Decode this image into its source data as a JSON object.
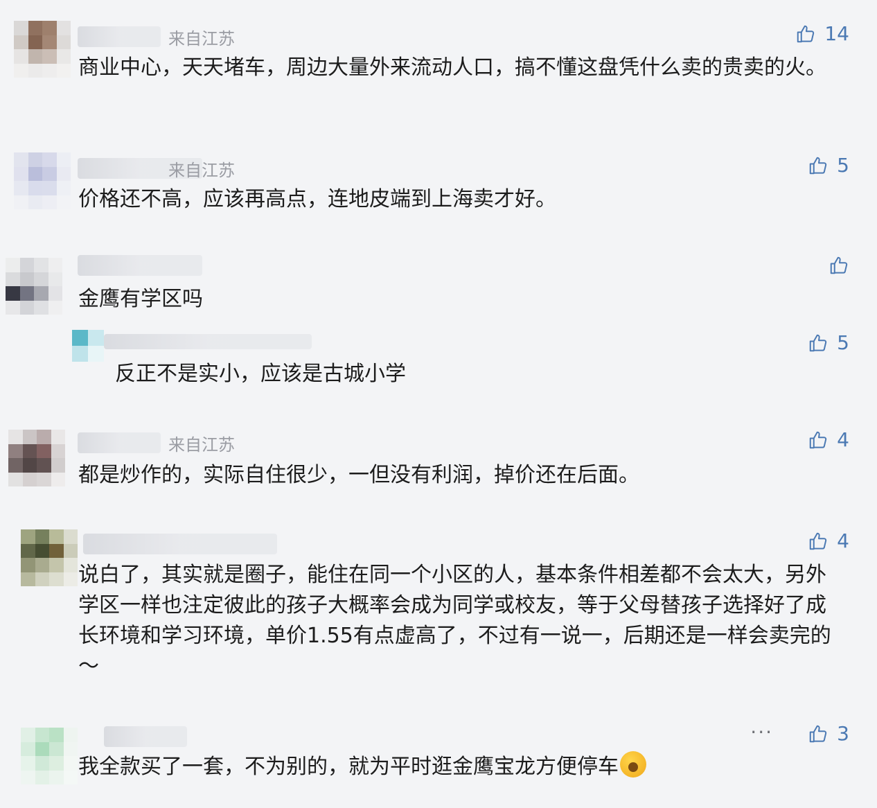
{
  "comments": [
    {
      "location": "来自江苏",
      "likes": "14",
      "text": "商业中心，天天堵车，周边大量外来流动人口，搞不懂这盘凭什么卖的贵卖的火。",
      "avatar_colors": [
        "#d9d7d6",
        "#8b6a57",
        "#9a7a66",
        "#e3e1e0",
        "#cfc8c3",
        "#7f5d4a",
        "#a0826f",
        "#dcd9d7",
        "#e6e4e3",
        "#bfb2aa",
        "#c9bcb3",
        "#e9e8e7",
        "#f0efee",
        "#ebeaea",
        "#eeeded",
        "#f2f1f0"
      ]
    },
    {
      "location": "来自江苏",
      "likes": "5",
      "text": "价格还不高，应该再高点，连地皮端到上海卖才好。",
      "avatar_colors": [
        "#e2e4ee",
        "#cdd0e4",
        "#d6d8ea",
        "#eceef4",
        "#dfe1ee",
        "#b8bcda",
        "#c7cae3",
        "#e9eaf2",
        "#e6e8f1",
        "#d8dbec",
        "#d9dcec",
        "#eef0f5",
        "#f0f1f5",
        "#e9ebf2",
        "#edeef4",
        "#f2f3f6"
      ]
    },
    {
      "location": "",
      "likes": "",
      "text": "金鹰有学区吗",
      "avatar_colors": [
        "#eceded",
        "#d3d4d8",
        "#e2e3e5",
        "#eeeeef",
        "#d9dadc",
        "#c6c7cb",
        "#d4d5d8",
        "#e8e9ea",
        "#2d2e3a",
        "#6d6e7c",
        "#a3a4ad",
        "#e3e3e6",
        "#e7e7e9",
        "#d2d3d7",
        "#dedfe2",
        "#efeff0"
      ]
    },
    {
      "location": "来自江苏",
      "likes": "4",
      "text": "都是炒作的，实际自住很少，一但没有利润，掉价还在后面。",
      "avatar_colors": [
        "#e6e4e4",
        "#c9c3c3",
        "#b8a9a9",
        "#e9e7e7",
        "#8b7a7a",
        "#5e4b4b",
        "#7c5a5a",
        "#d7d2d2",
        "#6b5d5d",
        "#4a3d3d",
        "#5a4a4a",
        "#d0cbcb",
        "#e2e0e0",
        "#d4cfcf",
        "#d9d5d5",
        "#eeecec"
      ]
    },
    {
      "location": "",
      "likes": "4",
      "text": "说白了，其实就是圈子，能住在同一个小区的人，基本条件相差都不会太大，另外学区一样也注定彼此的孩子大概率会成为同学或校友，等于父母替孩子选择好了成长环境和学习环境，单价1.55有点虚高了，不过有一说一，后期还是一样会卖完的～",
      "avatar_colors": [
        "#9aa07a",
        "#707a55",
        "#b5b895",
        "#dadbcd",
        "#5a6040",
        "#3d4528",
        "#6b5a30",
        "#c9cab6",
        "#8d9070",
        "#a6a88a",
        "#c2c3a8",
        "#e4e5da",
        "#b4b69a",
        "#cfd0bd",
        "#dcddcf",
        "#ecece6"
      ]
    },
    {
      "location": "",
      "likes": "3",
      "more": "···",
      "text": "我全款买了一套，不为别的，就为平时逛金鹰宝龙方便停车",
      "avatar_colors": [
        "#e1f0e6",
        "#c5e6cf",
        "#b7e0c3",
        "#eef5f0",
        "#d5ecdc",
        "#a8dab8",
        "#c9e7d2",
        "#f0f6f2",
        "#e6f3ea",
        "#cfe9d7",
        "#dceedf",
        "#f3f8f4",
        "#eef6f1",
        "#e3f1e7",
        "#ebf5ee",
        "#f5f9f6"
      ]
    }
  ],
  "reply": {
    "likes": "5",
    "text": "反正不是实小，应该是古城小学",
    "avatar_colors": [
      "#5bb8c8",
      "#c9e8ee",
      "#bfe3ea",
      "#e8f5f7"
    ]
  }
}
